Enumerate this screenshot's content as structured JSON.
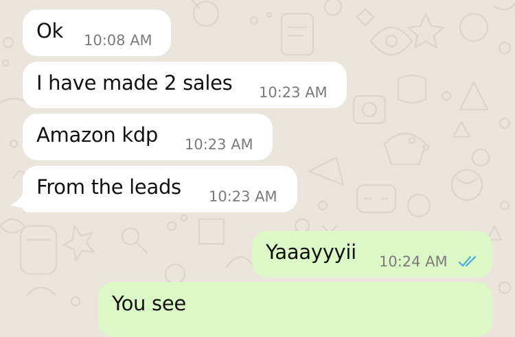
{
  "colors": {
    "background": "#ebe5de",
    "incoming_bubble": "#ffffff",
    "outgoing_bubble": "#dcf8c6",
    "text": "#111111",
    "timestamp": "#7a7a7a",
    "read_ticks": "#4fa8e0"
  },
  "messages": [
    {
      "direction": "incoming",
      "text": "Ok",
      "time": "10:08 AM"
    },
    {
      "direction": "incoming",
      "text": "I have made 2 sales",
      "time": "10:23 AM"
    },
    {
      "direction": "incoming",
      "text": "Amazon kdp",
      "time": "10:23 AM"
    },
    {
      "direction": "incoming",
      "text": "From the leads",
      "time": "10:23 AM"
    },
    {
      "direction": "outgoing",
      "text": "Yaaayyyii",
      "time": "10:24 AM",
      "status": "read-double-check-icon"
    },
    {
      "direction": "outgoing",
      "text": "You see",
      "time": ""
    }
  ]
}
